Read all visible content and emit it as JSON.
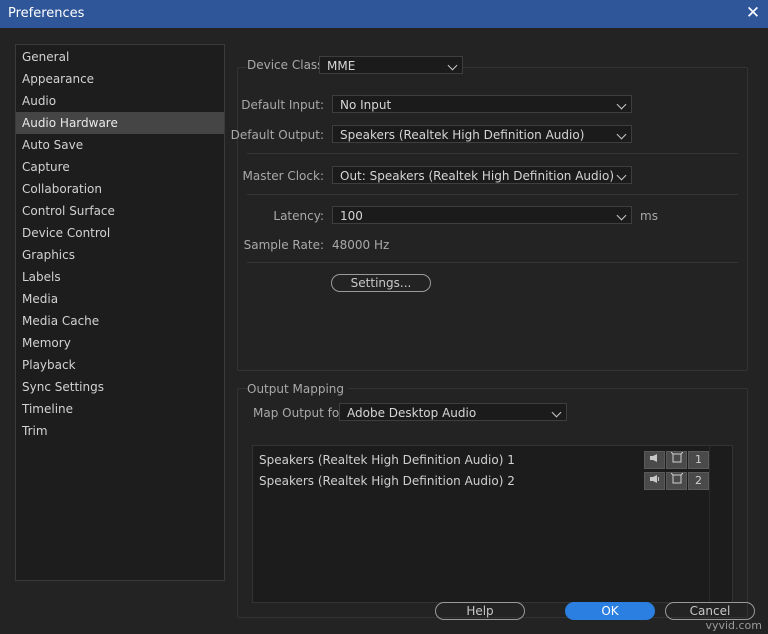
{
  "window": {
    "title": "Preferences"
  },
  "sidebar": {
    "items": [
      {
        "label": "General"
      },
      {
        "label": "Appearance"
      },
      {
        "label": "Audio"
      },
      {
        "label": "Audio Hardware"
      },
      {
        "label": "Auto Save"
      },
      {
        "label": "Capture"
      },
      {
        "label": "Collaboration"
      },
      {
        "label": "Control Surface"
      },
      {
        "label": "Device Control"
      },
      {
        "label": "Graphics"
      },
      {
        "label": "Labels"
      },
      {
        "label": "Media"
      },
      {
        "label": "Media Cache"
      },
      {
        "label": "Memory"
      },
      {
        "label": "Playback"
      },
      {
        "label": "Sync Settings"
      },
      {
        "label": "Timeline"
      },
      {
        "label": "Trim"
      }
    ],
    "active": "Audio Hardware"
  },
  "hardware": {
    "device_class_label": "Device Class:",
    "device_class_value": "MME",
    "default_input_label": "Default Input:",
    "default_input_value": "No Input",
    "default_output_label": "Default Output:",
    "default_output_value": "Speakers (Realtek High Definition Audio)",
    "master_clock_label": "Master Clock:",
    "master_clock_value": "Out: Speakers (Realtek High Definition Audio)",
    "latency_label": "Latency:",
    "latency_value": "100",
    "latency_unit": "ms",
    "sample_rate_label": "Sample Rate:",
    "sample_rate_value": "48000 Hz",
    "settings_button": "Settings..."
  },
  "output_mapping": {
    "title": "Output Mapping",
    "map_output_label": "Map Output for:",
    "map_output_value": "Adobe Desktop Audio",
    "rows": [
      {
        "label": "Speakers (Realtek High Definition Audio) 1",
        "channel": "1"
      },
      {
        "label": "Speakers (Realtek High Definition Audio) 2",
        "channel": "2"
      }
    ]
  },
  "footer": {
    "help": "Help",
    "ok": "OK",
    "cancel": "Cancel"
  },
  "watermark": "vyvid.com"
}
